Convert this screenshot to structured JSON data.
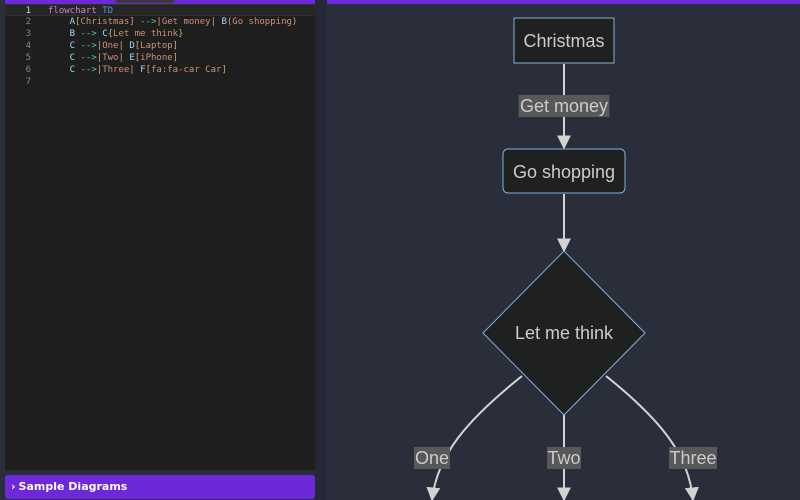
{
  "editor": {
    "lines": [
      {
        "num": "1",
        "active": true,
        "tokens": [
          {
            "t": "flowchart",
            "c": "kw"
          },
          {
            "t": " ",
            "c": ""
          },
          {
            "t": "TD",
            "c": "kw2"
          }
        ]
      },
      {
        "num": "2",
        "tokens": [
          {
            "t": "    A",
            "c": "id"
          },
          {
            "t": "[",
            "c": "br"
          },
          {
            "t": "Christmas",
            "c": "txt"
          },
          {
            "t": "]",
            "c": "br"
          },
          {
            "t": " -->",
            "c": "arrow"
          },
          {
            "t": "|",
            "c": "pipe"
          },
          {
            "t": "Get money",
            "c": "txt"
          },
          {
            "t": "| ",
            "c": "pipe"
          },
          {
            "t": "B",
            "c": "id"
          },
          {
            "t": "(",
            "c": "br"
          },
          {
            "t": "Go shopping",
            "c": "txt"
          },
          {
            "t": ")",
            "c": "br"
          }
        ]
      },
      {
        "num": "3",
        "tokens": [
          {
            "t": "    B",
            "c": "id"
          },
          {
            "t": " --> ",
            "c": "arrow"
          },
          {
            "t": "C",
            "c": "id"
          },
          {
            "t": "{",
            "c": "br"
          },
          {
            "t": "Let me think",
            "c": "txt"
          },
          {
            "t": "}",
            "c": "br"
          }
        ]
      },
      {
        "num": "4",
        "tokens": [
          {
            "t": "    C",
            "c": "id"
          },
          {
            "t": " -->",
            "c": "arrow"
          },
          {
            "t": "|",
            "c": "pipe"
          },
          {
            "t": "One",
            "c": "txt"
          },
          {
            "t": "| ",
            "c": "pipe"
          },
          {
            "t": "D",
            "c": "id"
          },
          {
            "t": "[",
            "c": "br"
          },
          {
            "t": "Laptop",
            "c": "txt"
          },
          {
            "t": "]",
            "c": "br"
          }
        ]
      },
      {
        "num": "5",
        "tokens": [
          {
            "t": "    C",
            "c": "id"
          },
          {
            "t": " -->",
            "c": "arrow"
          },
          {
            "t": "|",
            "c": "pipe"
          },
          {
            "t": "Two",
            "c": "txt"
          },
          {
            "t": "| ",
            "c": "pipe"
          },
          {
            "t": "E",
            "c": "id"
          },
          {
            "t": "[",
            "c": "br"
          },
          {
            "t": "iPhone",
            "c": "txt"
          },
          {
            "t": "]",
            "c": "br"
          }
        ]
      },
      {
        "num": "6",
        "tokens": [
          {
            "t": "    C",
            "c": "id"
          },
          {
            "t": " -->",
            "c": "arrow"
          },
          {
            "t": "|",
            "c": "pipe"
          },
          {
            "t": "Three",
            "c": "txt"
          },
          {
            "t": "| ",
            "c": "pipe"
          },
          {
            "t": "F",
            "c": "id"
          },
          {
            "t": "[",
            "c": "br"
          },
          {
            "t": "fa:fa-car Car",
            "c": "txt"
          },
          {
            "t": "]",
            "c": "br"
          }
        ]
      },
      {
        "num": "7",
        "tokens": []
      }
    ]
  },
  "sample_diagrams": {
    "label": "Sample Diagrams"
  },
  "diagram": {
    "nodes": {
      "christmas": "Christmas",
      "go_shopping": "Go shopping",
      "let_me_think": "Let me think"
    },
    "edges": {
      "get_money": "Get money",
      "one": "One",
      "two": "Two",
      "three": "Three"
    },
    "colors": {
      "node_fill": "#1f2020",
      "node_stroke": "#81b1db",
      "edge": "#d3d3d3",
      "label_bg": "#585858",
      "text": "#cccccc"
    }
  }
}
